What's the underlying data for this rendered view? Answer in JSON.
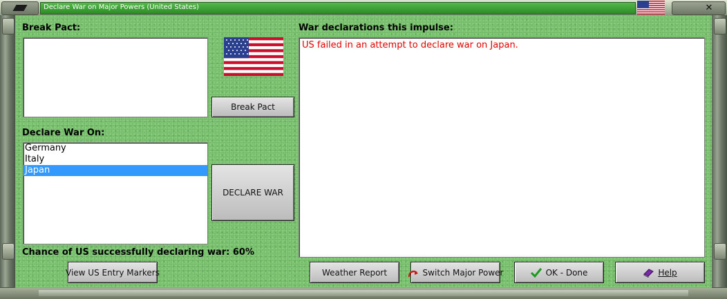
{
  "window": {
    "title": "Declare War on Major Powers (United States)"
  },
  "break_pact": {
    "label": "Break Pact:",
    "items": [],
    "button_label": "Break Pact"
  },
  "declare_war": {
    "label": "Declare War On:",
    "items": [
      "Germany",
      "Italy",
      "Japan"
    ],
    "selected": "Japan",
    "button_label": "DECLARE WAR"
  },
  "chance_text": "Chance of US successfully declaring war: 60%",
  "declarations": {
    "label": "War declarations this impulse:",
    "messages": [
      "US failed in an attempt to declare war on Japan."
    ],
    "message_color": "#e00000"
  },
  "buttons": {
    "view_entry_markers": "View US Entry Markers",
    "weather_report": "Weather Report",
    "switch_major_power": "Switch Major Power",
    "ok_done": "OK - Done",
    "help": "Help"
  },
  "icons": {
    "flag": "us-flag-icon",
    "switch": "red-arrow-icon",
    "ok": "green-checkmark-icon",
    "help": "purple-book-icon",
    "close": "close-icon",
    "menu": "menu-icon"
  },
  "colors": {
    "felt_green": "#74bb69",
    "title_green": "#3aa033",
    "selection_blue": "#3399ff"
  }
}
